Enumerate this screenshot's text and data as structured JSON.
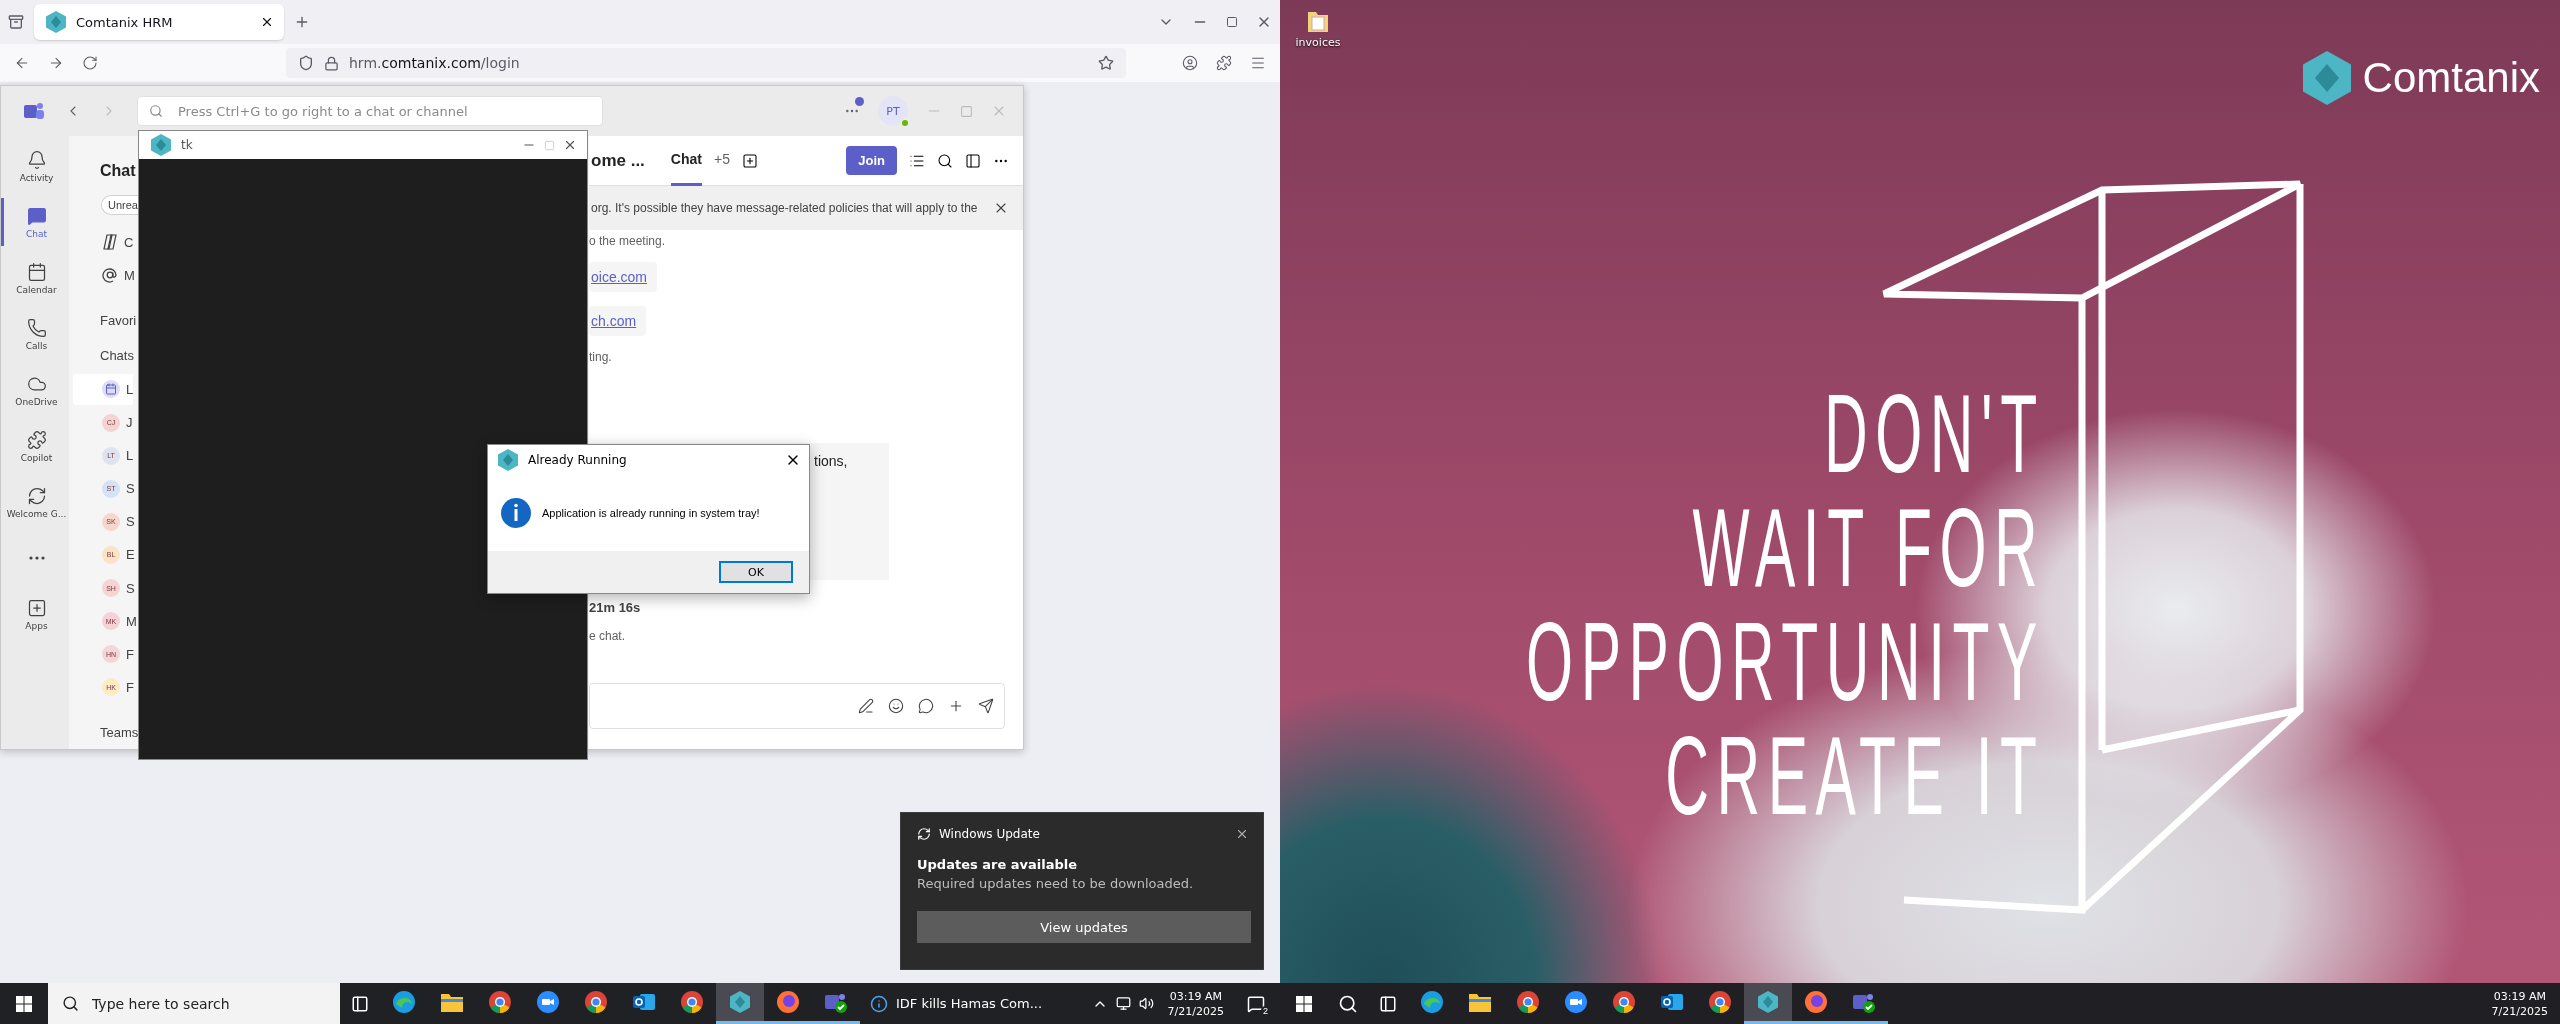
{
  "left": {
    "browser": {
      "tab": "Comtanix HRM",
      "url": {
        "pre": "hrm.",
        "domain": "comtanix.com",
        "path": "/login"
      }
    },
    "teams": {
      "search_placeholder": "Press Ctrl+G to go right to a chat or channel",
      "avatar": "PT",
      "rail": [
        {
          "kind": "bell",
          "label": "Activity",
          "selected": false
        },
        {
          "kind": "chat",
          "label": "Chat",
          "selected": true
        },
        {
          "kind": "calendar",
          "label": "Calendar",
          "selected": false
        },
        {
          "kind": "phone",
          "label": "Calls",
          "selected": false
        },
        {
          "kind": "cloud",
          "label": "OneDrive",
          "selected": false
        },
        {
          "kind": "copilot",
          "label": "Copilot",
          "selected": false
        },
        {
          "kind": "welcome",
          "label": "Welcome G...",
          "selected": false
        },
        {
          "kind": "more",
          "selected": false
        },
        {
          "kind": "apps",
          "label": "Apps",
          "selected": false
        }
      ],
      "list": {
        "title": "Chat",
        "filter": "Unrea",
        "top_rows": [
          {
            "kind": "copilot",
            "text": "C"
          },
          {
            "kind": "mention",
            "text": "M"
          }
        ],
        "favorites": "Favori",
        "chats_heading": "Chats",
        "chats": [
          {
            "kind": "meeting",
            "text": "L",
            "selected": true
          },
          {
            "kind": "person",
            "initials": "CJ",
            "color": "#f4d3d3",
            "text": "J",
            "selected": false
          },
          {
            "kind": "person",
            "initials": "LT",
            "color": "#dfe3ef",
            "text": "L",
            "selected": false
          },
          {
            "kind": "person",
            "initials": "ST",
            "color": "#d5e2f5",
            "text": "S",
            "selected": false
          },
          {
            "kind": "person",
            "initials": "SK",
            "color": "#f7d7cd",
            "text": "S",
            "selected": false
          },
          {
            "kind": "person",
            "initials": "BL",
            "color": "#fbe3c8",
            "text": "E",
            "selected": false
          },
          {
            "kind": "person",
            "initials": "SH",
            "color": "#f6d4d4",
            "text": "S",
            "selected": false
          },
          {
            "kind": "person",
            "initials": "MK",
            "color": "#f5d2d8",
            "text": "M",
            "selected": false
          },
          {
            "kind": "person",
            "initials": "HN",
            "color": "#f5d5d5",
            "text": "F",
            "selected": false
          },
          {
            "kind": "person",
            "initials": "HK",
            "color": "#fbecc4",
            "text": "F",
            "selected": false
          }
        ],
        "teams_heading": "Teams"
      },
      "header": {
        "title": "ome ...",
        "tabs": [
          {
            "label": "Chat",
            "selected": true
          },
          {
            "label": "+5",
            "selected": false
          }
        ],
        "join": "Join"
      },
      "banner": "org. It's possible they have message-related policies that will apply to the",
      "messages": [
        {
          "kind": "note",
          "text": "o the meeting."
        },
        {
          "kind": "link",
          "text": "oice.com"
        },
        {
          "kind": "link",
          "text": "ch.com"
        },
        {
          "kind": "note",
          "text": "ting."
        },
        {
          "kind": "card",
          "text": "tions,"
        },
        {
          "kind": "bold",
          "text": "21m 16s"
        },
        {
          "kind": "note",
          "text": "e chat."
        }
      ]
    },
    "tk_window": {
      "title": "tk"
    },
    "dialog": {
      "title": "Already Running",
      "message": "Application is already running in system tray!",
      "ok": "OK"
    },
    "notification": {
      "app": "Windows Update",
      "title": "Updates are available",
      "body": "Required updates need to be downloaded.",
      "button": "View updates"
    },
    "taskbar": {
      "search_placeholder": "Type here to search",
      "apps": [
        {
          "kind": "edge",
          "open": false,
          "selected": false
        },
        {
          "kind": "files",
          "open": false,
          "selected": false
        },
        {
          "kind": "chrome",
          "open": false,
          "selected": false
        },
        {
          "kind": "zoom",
          "open": false,
          "selected": false
        },
        {
          "kind": "chrome",
          "open": false,
          "selected": false
        },
        {
          "kind": "outlook",
          "open": false,
          "selected": false
        },
        {
          "kind": "chrome",
          "open": false,
          "selected": false
        },
        {
          "kind": "tk",
          "open": true,
          "selected": true
        },
        {
          "kind": "firefox",
          "open": true,
          "selected": false
        },
        {
          "kind": "teams",
          "open": true,
          "selected": false
        }
      ],
      "news": "IDF kills Hamas Com...",
      "time": "03:19 AM",
      "date": "7/21/2025",
      "notifications": "2"
    }
  },
  "right": {
    "desktop_icons": [
      {
        "label": "invoices"
      }
    ],
    "logo": "Comtanix",
    "slogan": [
      "DON'T",
      "WAIT FOR",
      "OPPORTUNITY",
      "CREATE IT"
    ],
    "taskbar": {
      "apps": [
        {
          "kind": "edge",
          "open": false,
          "selected": false
        },
        {
          "kind": "files",
          "open": false,
          "selected": false
        },
        {
          "kind": "chrome",
          "open": false,
          "selected": false
        },
        {
          "kind": "zoom",
          "open": false,
          "selected": false
        },
        {
          "kind": "chrome",
          "open": false,
          "selected": false
        },
        {
          "kind": "outlook",
          "open": false,
          "selected": false
        },
        {
          "kind": "chrome",
          "open": false,
          "selected": false
        },
        {
          "kind": "tk",
          "open": true,
          "selected": true
        },
        {
          "kind": "firefox",
          "open": true,
          "selected": false
        },
        {
          "kind": "teams",
          "open": true,
          "selected": false
        }
      ],
      "time": "03:19 AM",
      "date": "7/21/2025"
    }
  }
}
